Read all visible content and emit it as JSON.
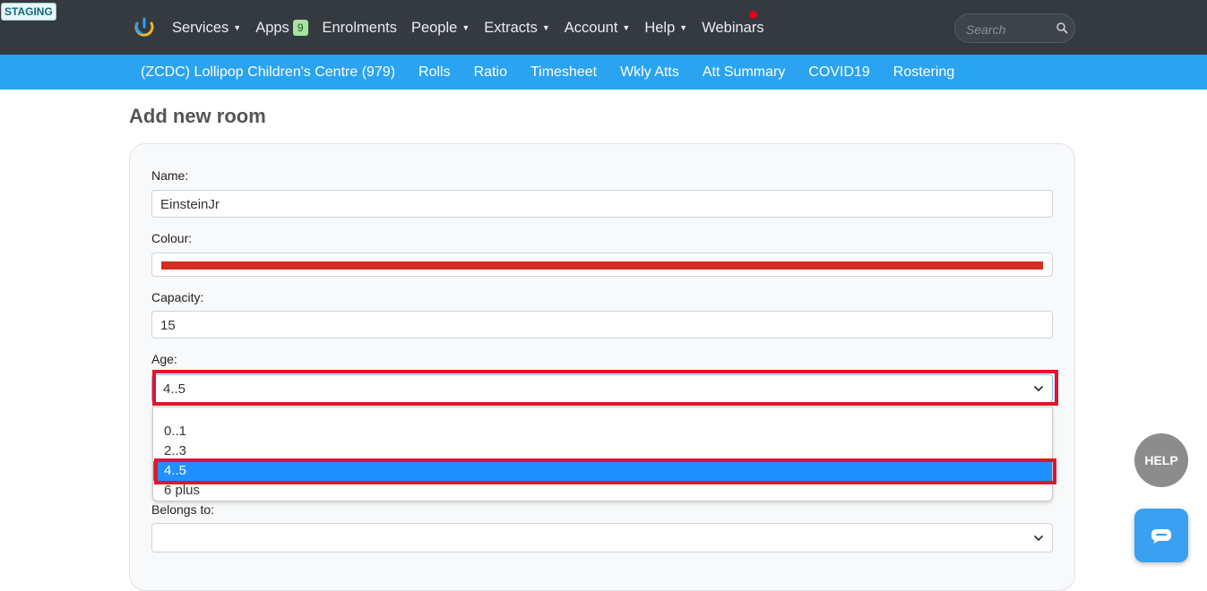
{
  "env_badge": "STAGING",
  "nav": {
    "items": [
      {
        "label": "Services",
        "caret": true
      },
      {
        "label": "Apps",
        "badge": "9"
      },
      {
        "label": "Enrolments"
      },
      {
        "label": "People",
        "caret": true
      },
      {
        "label": "Extracts",
        "caret": true
      },
      {
        "label": "Account",
        "caret": true
      },
      {
        "label": "Help",
        "caret": true
      },
      {
        "label": "Webinars",
        "notification": true
      }
    ]
  },
  "search": {
    "placeholder": "Search",
    "value": ""
  },
  "subnav": {
    "items": [
      "(ZCDC) Lollipop Children's Centre (979)",
      "Rolls",
      "Ratio",
      "Timesheet",
      "Wkly Atts",
      "Att Summary",
      "COVID19",
      "Rostering"
    ]
  },
  "page": {
    "title": "Add new room"
  },
  "form": {
    "name_label": "Name:",
    "name_value": "EinsteinJr",
    "colour_label": "Colour:",
    "colour_value": "#d62d20",
    "capacity_label": "Capacity:",
    "capacity_value": "15",
    "age_label": "Age:",
    "age_value": "4..5",
    "age_options": [
      "",
      "0..1",
      "2..3",
      "4..5",
      "6 plus"
    ],
    "belongs_label": "Belongs to:",
    "belongs_value": ""
  },
  "widgets": {
    "help_label": "HELP"
  },
  "colors": {
    "topbar": "#343a40",
    "subnav": "#2aa3f0",
    "highlight": "#e3142c",
    "selected_option": "#1e90ff"
  }
}
